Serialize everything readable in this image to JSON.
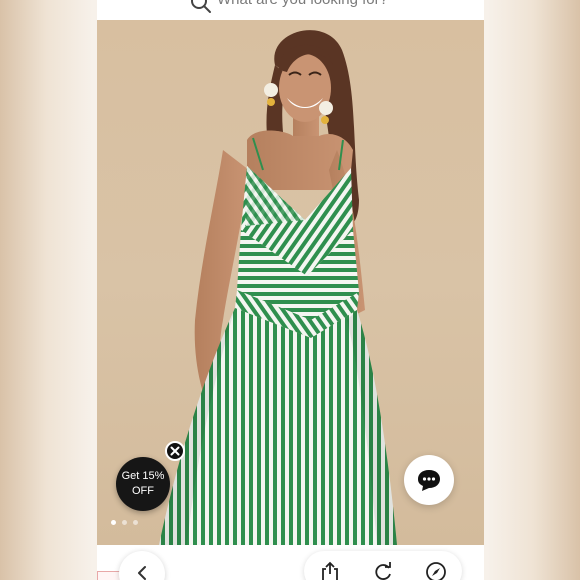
{
  "search": {
    "placeholder": "What are you looking for?"
  },
  "promo": {
    "line1": "Get 15%",
    "line2": "OFF"
  },
  "carousel": {
    "total_dots": 3,
    "active_index": 0
  },
  "icons": {
    "search": "search-icon",
    "close": "close-icon",
    "chat": "chat-bubble-icon",
    "back": "chevron-left-icon",
    "share": "share-icon",
    "reload": "reload-icon",
    "compass": "compass-icon"
  },
  "colors": {
    "dress_green": "#2f8f4e",
    "backdrop": "#d8bfa0",
    "promo_bg": "#161616"
  }
}
